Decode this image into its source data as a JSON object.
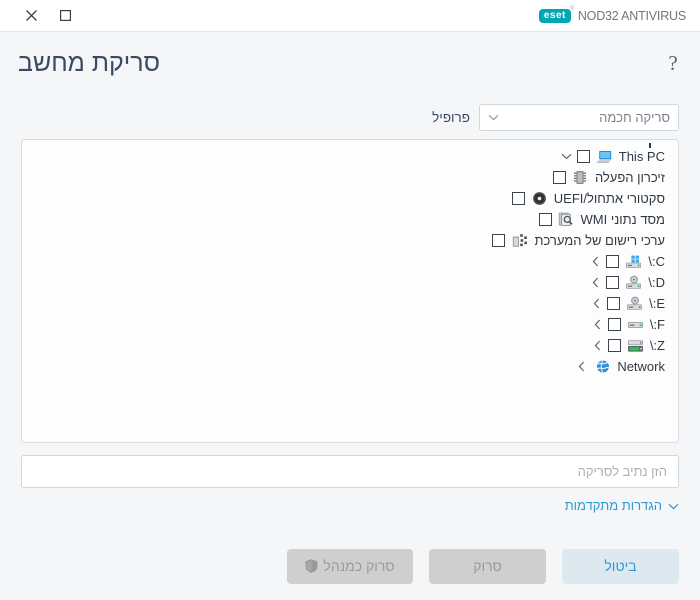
{
  "titlebar": {
    "close_label": "×",
    "maximize_label": "□",
    "brand_logo_text": "eset",
    "brand_logo_tm": "®",
    "brand_product": "NOD32 ANTIVIRUS",
    "close_icon_name": "close-icon",
    "maximize_icon_name": "maximize-icon"
  },
  "header": {
    "title": "סריקת מחשב",
    "help_label": "?"
  },
  "profile": {
    "label": "פרופיל",
    "selected": "סריקה חכמה",
    "options": [
      "סריקה חכמה"
    ]
  },
  "tree": {
    "items": [
      {
        "label": "This PC",
        "icon": "computer-icon",
        "twisty": "chevron-down",
        "checked": false
      },
      {
        "label": "זיכרון הפעלה",
        "icon": "memory-icon",
        "twisty": "none",
        "checked": false
      },
      {
        "label": "סקטורי אתחול/UEFI",
        "icon": "disc-icon",
        "twisty": "none",
        "checked": false
      },
      {
        "label": "מסד נתוני WMI",
        "icon": "wmi-database-icon",
        "twisty": "none",
        "checked": false
      },
      {
        "label": "ערכי רישום של המערכת",
        "icon": "registry-icon",
        "twisty": "none",
        "checked": false
      },
      {
        "label": "C:\\",
        "icon": "system-drive-icon",
        "twisty": "chevron-collapsed",
        "checked": false
      },
      {
        "label": "D:\\",
        "icon": "optical-drive-icon",
        "twisty": "chevron-collapsed",
        "checked": false
      },
      {
        "label": "E:\\",
        "icon": "optical-drive-icon",
        "twisty": "chevron-collapsed",
        "checked": false
      },
      {
        "label": "F:\\",
        "icon": "drive-icon",
        "twisty": "chevron-collapsed",
        "checked": false
      },
      {
        "label": "Z:\\",
        "icon": "network-drive-icon",
        "twisty": "chevron-collapsed",
        "checked": false
      },
      {
        "label": "Network",
        "icon": "network-icon",
        "twisty": "chevron-collapsed",
        "checked": null
      }
    ]
  },
  "path": {
    "value": "",
    "placeholder": "הזן נתיב לסריקה"
  },
  "advanced": {
    "label": "הגדרות מתקדמות"
  },
  "footer": {
    "cancel_label": "ביטול",
    "scan_label": "סרוק",
    "scan_admin_label": "סרוק כמנהל"
  },
  "colors": {
    "accent": "#2f9bd4",
    "brand_teal": "#00a7b5",
    "title_text": "#3b4a60",
    "page_bg": "#f4f6f8",
    "panel_bg": "#fdfdfd",
    "disabled_btn": "#cfcfcf",
    "cancel_btn": "#dee8ef"
  }
}
